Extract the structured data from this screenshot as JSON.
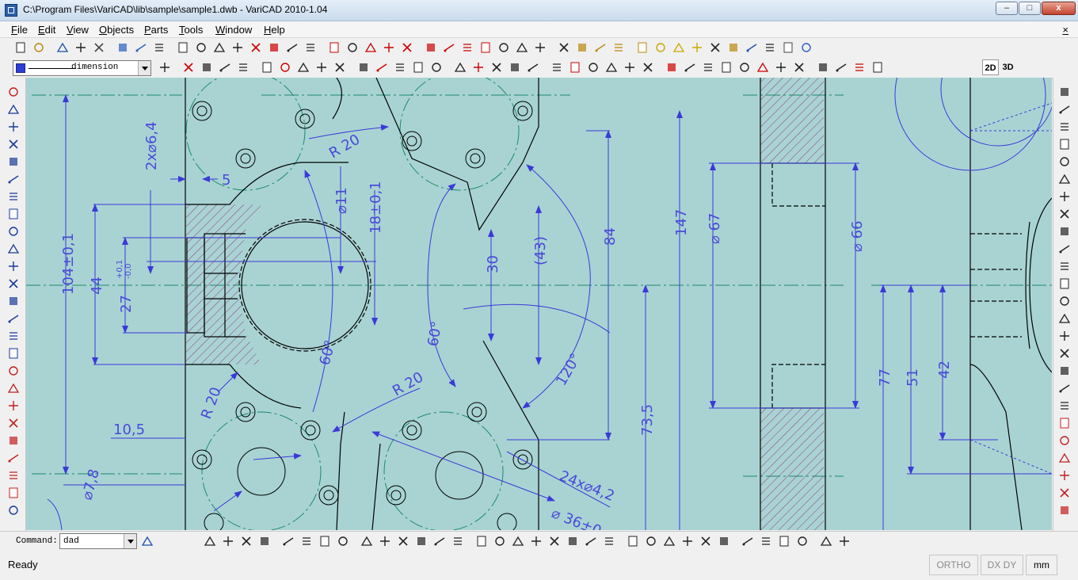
{
  "window": {
    "title": "C:\\Program Files\\VariCAD\\lib\\sample\\sample1.dwb - VariCAD 2010-1.04"
  },
  "menu": {
    "items": [
      "File",
      "Edit",
      "View",
      "Objects",
      "Parts",
      "Tools",
      "Window",
      "Help"
    ],
    "close": "×"
  },
  "window_controls": {
    "minimize": "–",
    "maximize": "□",
    "close": "x"
  },
  "toolbar2": {
    "layer_name": "dimension",
    "view_2d": "2D",
    "view_3d": "3D"
  },
  "command": {
    "label": "Command:",
    "value": "dad"
  },
  "status": {
    "text": "Ready",
    "ortho": "ORTHO",
    "dxdy": "DX DY",
    "units": "mm"
  },
  "drawing": {
    "dims": [
      "2x⌀6,4",
      "5",
      "R 20",
      "⌀11",
      "18±0,1",
      "104±0,1",
      "44",
      "27",
      "+0,1",
      "-0,0",
      "30",
      "(43)",
      "84",
      "147",
      "⌀ 67",
      "⌀ 66",
      "60°",
      "60°",
      "R 20",
      "120°",
      "R 20",
      "10,5",
      "⌀7,8",
      "73,5",
      "24x⌀4,2",
      "⌀ 36±0",
      "77",
      "51",
      "42"
    ]
  },
  "colors": {
    "canvas": "#a9d3d3",
    "dimension": "#4a4ad8",
    "contour": "#000000",
    "centerline": "#1a8a6a",
    "hatch": "#8a3a8a"
  }
}
